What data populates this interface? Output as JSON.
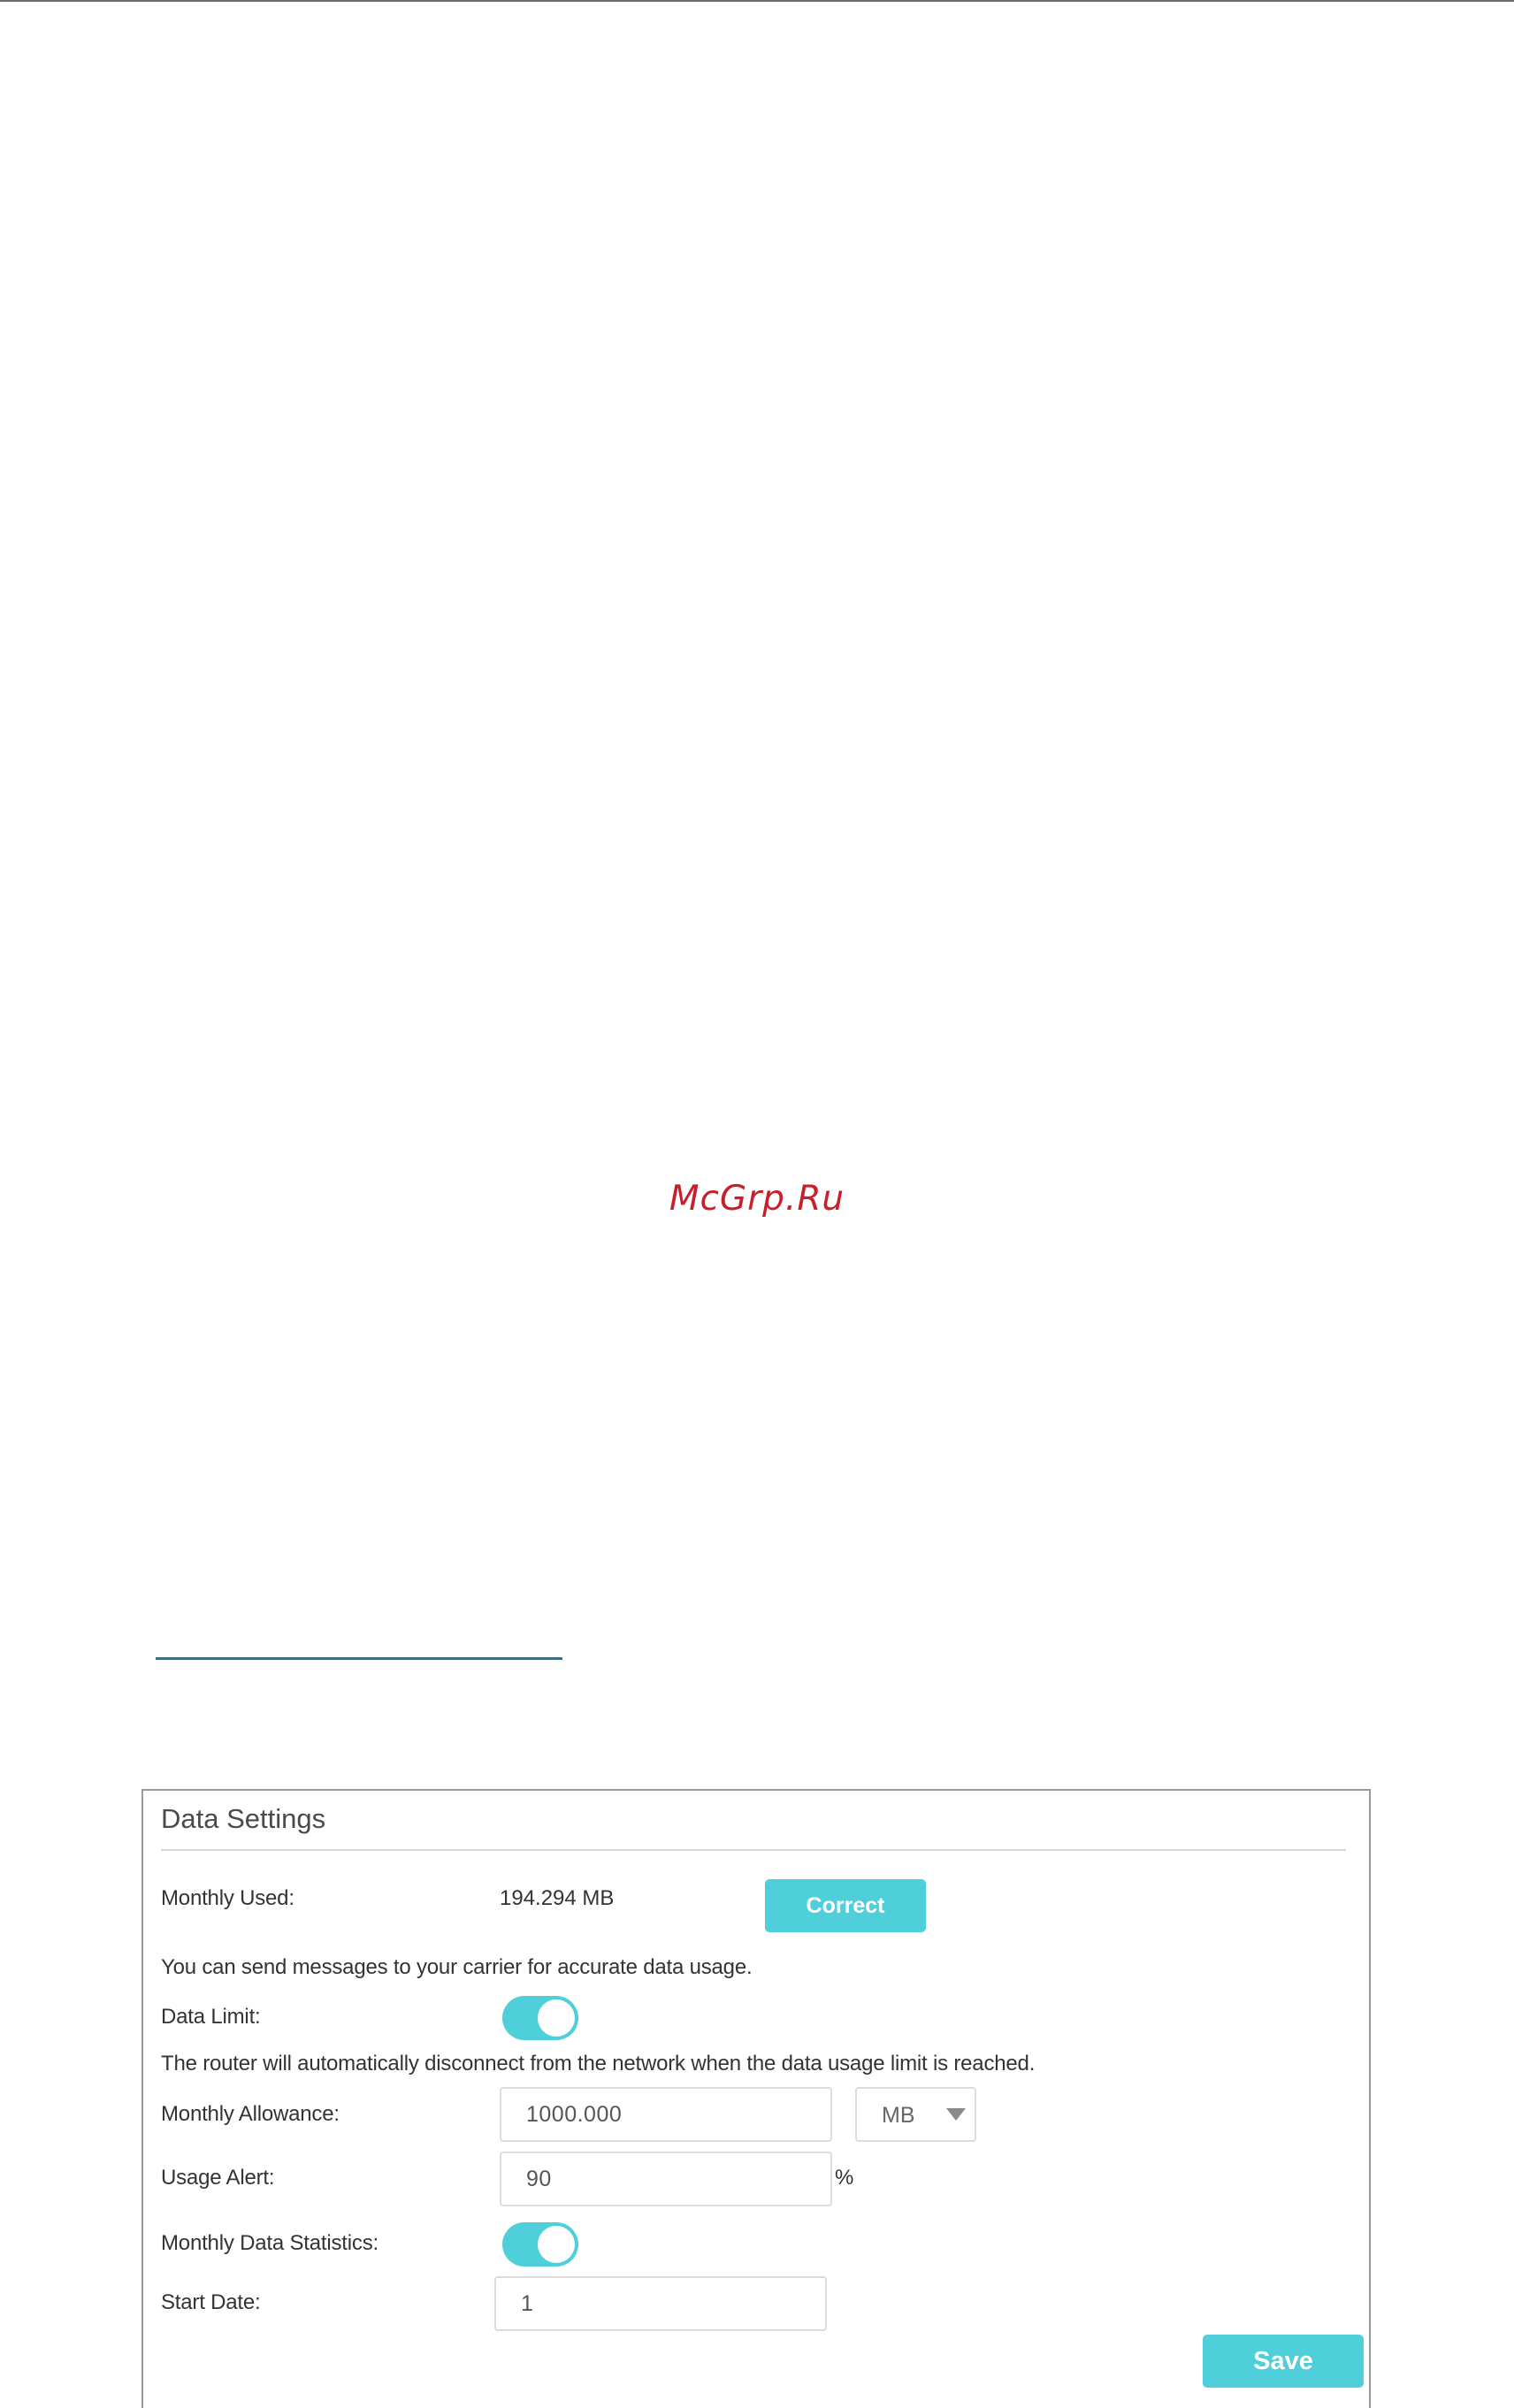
{
  "watermark": "McGrp.Ru",
  "panel": {
    "title": "Data Settings",
    "monthly_used_label": "Monthly Used:",
    "monthly_used_value": "194.294 MB",
    "correct_button": "Correct",
    "carrier_note": "You can send messages to your carrier for accurate data usage.",
    "data_limit_label": "Data Limit:",
    "data_limit_enabled": true,
    "disconnect_note": "The router will automatically disconnect from the network when the data usage limit is reached.",
    "monthly_allowance_label": "Monthly Allowance:",
    "monthly_allowance_value": "1000.000",
    "allowance_unit_selected": "MB",
    "usage_alert_label": "Usage Alert:",
    "usage_alert_value": "90",
    "usage_alert_unit": "%",
    "monthly_stats_label": "Monthly Data Statistics:",
    "monthly_stats_enabled": true,
    "start_date_label": "Start Date:",
    "start_date_value": "1",
    "save_button": "Save"
  },
  "colors": {
    "accent": "#4fcfda",
    "watermark": "#c8202a"
  }
}
